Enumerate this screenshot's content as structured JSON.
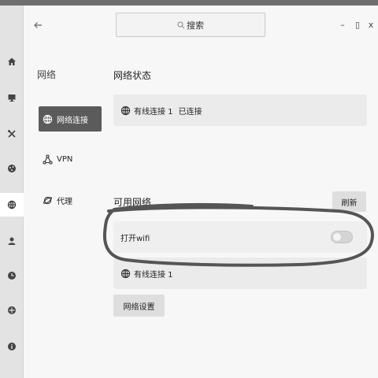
{
  "search": {
    "placeholder": "搜索"
  },
  "window": {
    "minimize": "–",
    "maximize": "▯",
    "close": "x"
  },
  "sidebar": {
    "title": "网络",
    "items": [
      {
        "label": "网络连接",
        "active": true
      },
      {
        "label": "VPN",
        "active": false
      },
      {
        "label": "代理",
        "active": false
      }
    ]
  },
  "main": {
    "status_title": "网络状态",
    "status_connection": "有线连接 1",
    "status_state": "已连接",
    "available_title": "可用网络",
    "refresh_label": "刷新",
    "wifi_label": "打开wifi",
    "wifi_enabled": false,
    "wired_connection": "有线连接 1",
    "settings_label": "网络设置"
  }
}
